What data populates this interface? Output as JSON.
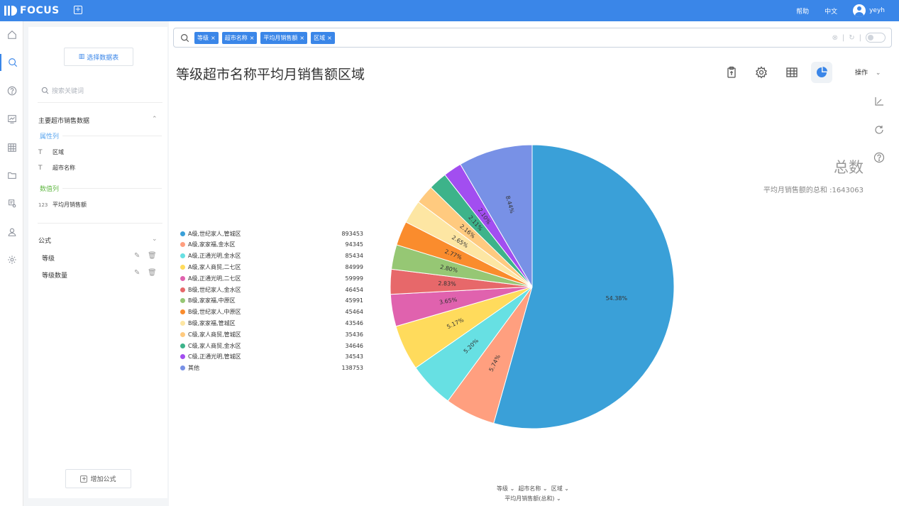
{
  "header": {
    "logo": "FOCUS",
    "new_tab": "+",
    "help": "帮助",
    "language": "中文",
    "user": "yeyh"
  },
  "rail": [
    "home-icon",
    "search-icon",
    "help-icon",
    "dashboard-icon",
    "table-icon",
    "folder-icon",
    "report-icon",
    "user-icon",
    "settings-icon"
  ],
  "panel": {
    "select_table": "选择数据表",
    "keyword_placeholder": "搜索关键词",
    "dataset": "主要超市销售数据",
    "attribute_label": "属性列",
    "attributes": [
      "区域",
      "超市名称"
    ],
    "measure_label": "数值列",
    "measure_prefix": "123",
    "measures": [
      "平均月销售额"
    ],
    "formula_title": "公式",
    "formulas": [
      "等级",
      "等级数量"
    ],
    "add_formula": "增加公式"
  },
  "search": {
    "tags": [
      "等级",
      "超市名称",
      "平均月销售额",
      "区域"
    ]
  },
  "main": {
    "title": "等级超市名称平均月销售额区域",
    "operations": "操作",
    "total_title": "总数",
    "total_sub": "平均月销售额的总和 :1643063"
  },
  "colors": {
    "accent": "#3a86e8"
  },
  "chart_data": {
    "type": "pie",
    "series": [
      {
        "name": "A级,世纪家人,管城区",
        "value": 893453,
        "percent": "54.38%",
        "color": "#3aa0d8"
      },
      {
        "name": "A级,家家福,金水区",
        "value": 94345,
        "percent": "5.74%",
        "color": "#ff9f7f"
      },
      {
        "name": "A级,正通光明,金水区",
        "value": 85434,
        "percent": "5.20%",
        "color": "#67e0e3"
      },
      {
        "name": "A级,家人商贸,二七区",
        "value": 84999,
        "percent": "5.17%",
        "color": "#ffdb5c"
      },
      {
        "name": "A级,正通光明,二七区",
        "value": 59999,
        "percent": "3.65%",
        "color": "#e062ae"
      },
      {
        "name": "B级,世纪家人,金水区",
        "value": 46454,
        "percent": "2.83%",
        "color": "#e7686a"
      },
      {
        "name": "B级,家家福,中原区",
        "value": 45991,
        "percent": "2.80%",
        "color": "#96c774"
      },
      {
        "name": "B级,世纪家人,中原区",
        "value": 45464,
        "percent": "2.77%",
        "color": "#fa8c2d"
      },
      {
        "name": "B级,家家福,管城区",
        "value": 43546,
        "percent": "2.65%",
        "color": "#fde6a3"
      },
      {
        "name": "C级,家人商贸,管城区",
        "value": 35436,
        "percent": "2.16%",
        "color": "#ffca7f"
      },
      {
        "name": "C级,家人商贸,金水区",
        "value": 34646,
        "percent": "2.11%",
        "color": "#3db38a"
      },
      {
        "name": "C级,正通光明,管城区",
        "value": 34543,
        "percent": "2.10%",
        "color": "#a24ef0"
      },
      {
        "name": "其他",
        "value": 138753,
        "percent": "8.44%",
        "color": "#7891e6"
      }
    ]
  },
  "axis_fields": {
    "dims": [
      "等级",
      "超市名称",
      "区域"
    ],
    "measure": "平均月销售额(总和)"
  }
}
